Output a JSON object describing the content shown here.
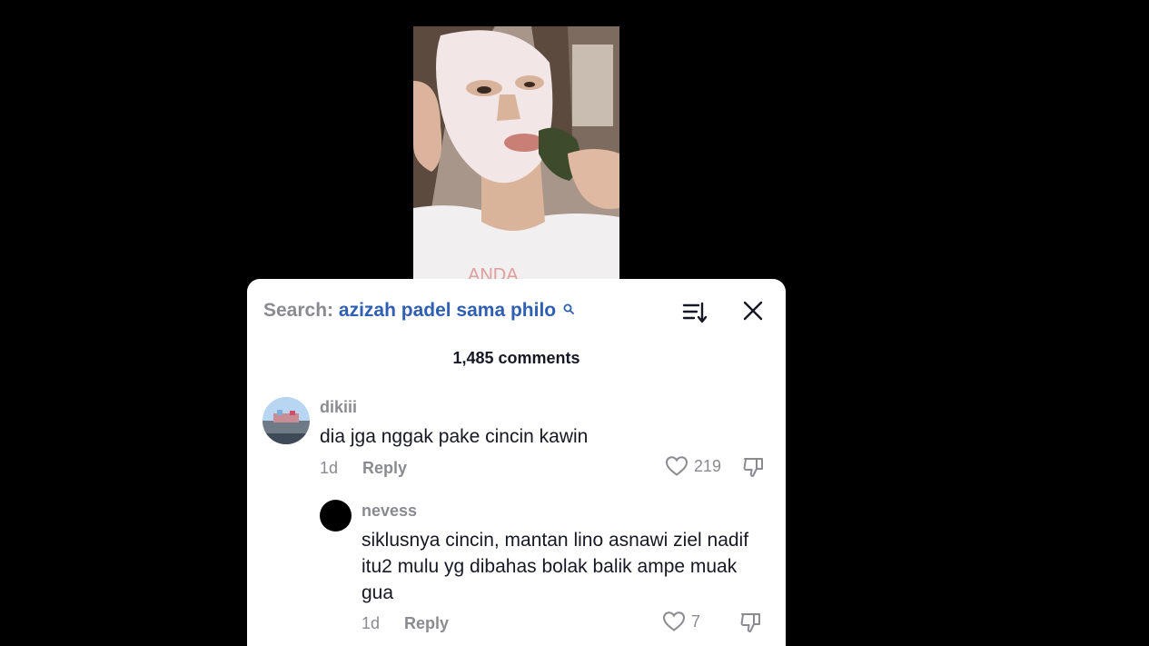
{
  "search": {
    "prefix": "Search:",
    "query": "azizah padel sama philo"
  },
  "header": {
    "comments_count": "1,485 comments",
    "sort_icon": "sort-icon",
    "close_icon": "close-icon"
  },
  "comments": [
    {
      "username": "dikiii",
      "text": "dia jga nggak pake cincin kawin",
      "time": "1d",
      "reply_label": "Reply",
      "likes": "219"
    }
  ],
  "replies": [
    {
      "username": "nevess",
      "text": "siklusnya cincin, mantan lino asnawi ziel nadif itu2 mulu yg dibahas bolak balik ampe muak gua",
      "time": "1d",
      "reply_label": "Reply",
      "likes": "7"
    }
  ],
  "colors": {
    "background": "#000000",
    "sheet": "#ffffff",
    "muted_text": "#8a8b91",
    "query_blue": "#2f5fb3",
    "primary_text": "#161823"
  }
}
